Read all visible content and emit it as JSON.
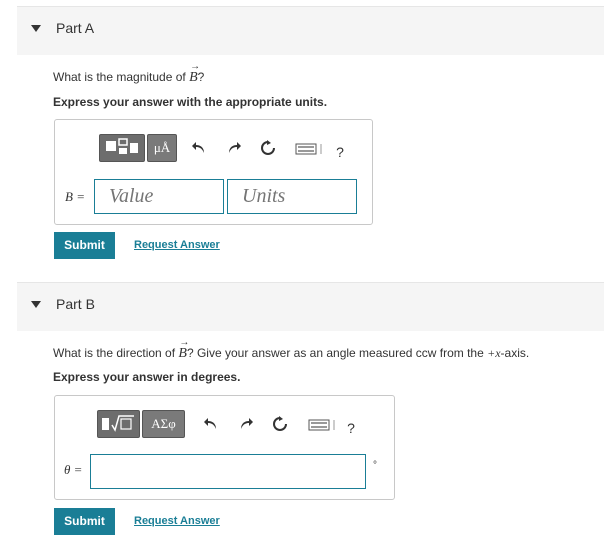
{
  "part_a": {
    "title": "Part A",
    "question_prefix": "What is the magnitude of ",
    "question_var": "B",
    "question_suffix": "?",
    "instruction": "Express your answer with the appropriate units.",
    "toolbar": {
      "template_icon": "template-icon",
      "units_label": "μÅ",
      "help": "?"
    },
    "variable_label": "B =",
    "value_placeholder": "Value",
    "units_placeholder": "Units",
    "submit": "Submit",
    "request": "Request Answer"
  },
  "part_b": {
    "title": "Part B",
    "question_prefix": "What is the direction of ",
    "question_var": "B",
    "question_middle": "? Give your answer as an angle measured ccw from the ",
    "question_axis": "+x",
    "question_suffix": "-axis.",
    "instruction": "Express your answer in degrees.",
    "toolbar": {
      "sqrt_label": "√□",
      "greek_label": "ΑΣφ",
      "help": "?"
    },
    "variable_label": "θ =",
    "unit_symbol": "°",
    "submit": "Submit",
    "request": "Request Answer"
  },
  "colors": {
    "accent": "#1a7e96",
    "header_bg": "#f5f5f5"
  }
}
